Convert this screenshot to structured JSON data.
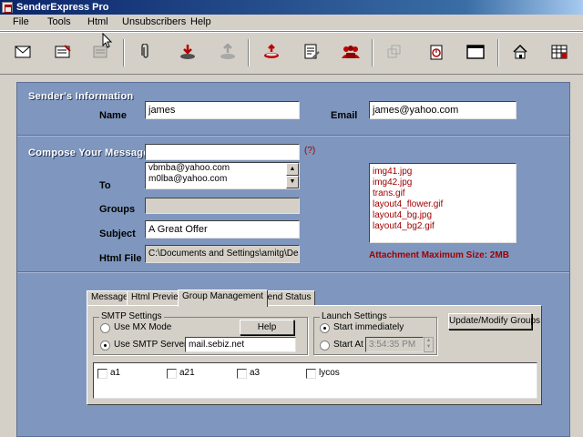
{
  "window": {
    "title": "SenderExpress Pro"
  },
  "menu": [
    "File",
    "Tools",
    "Html",
    "Unsubscribers",
    "Help"
  ],
  "toolbar": {
    "icons": [
      "envelope-icon",
      "compose-icon",
      "template-icon",
      "attach-icon",
      "download-icon",
      "upload-icon",
      "send-icon",
      "edit-icon",
      "group-icon",
      "copy-icon",
      "timer-icon",
      "window-icon",
      "home-icon",
      "grid-icon"
    ]
  },
  "sender": {
    "section_title": "Sender's Information",
    "name_label": "Name",
    "name_value": "james",
    "email_label": "Email",
    "email_value": "james@yahoo.com"
  },
  "compose": {
    "section_title": "Compose Your Message",
    "help_mark": "(?)",
    "to_label": "To",
    "to_list": [
      "vbmba@yahoo.com",
      "m0lba@yahoo.com"
    ],
    "groups_label": "Groups",
    "groups_value": "",
    "subject_label": "Subject",
    "subject_value": "A Great Offer",
    "htmlfile_label": "Html File",
    "htmlfile_value": "C:\\Documents and Settings\\amitg\\Desktop",
    "attachments": [
      "img41.jpg",
      "img42.jpg",
      "trans.gif",
      "layout4_flower.gif",
      "layout4_bg.jpg",
      "layout4_bg2.gif"
    ],
    "attachment_note": "Attachment Maximum Size: 2MB"
  },
  "tabs": [
    {
      "label": "Message",
      "active": false
    },
    {
      "label": "Html Preview",
      "active": false
    },
    {
      "label": "Group Management",
      "active": true
    },
    {
      "label": "Send Status",
      "active": false
    }
  ],
  "smtp": {
    "title": "SMTP Settings",
    "option_mx": "Use MX Mode",
    "option_smtp": "Use SMTP Server",
    "selected": "smtp",
    "server_value": "mail.sebiz.net",
    "help_button": "Help"
  },
  "launch": {
    "title": "Launch Settings",
    "option_immediate": "Start immediately",
    "option_at": "Start At",
    "selected": "immediate",
    "time_value": "3:54:35 PM"
  },
  "update_button": "Update/Modify Groups",
  "groups": [
    "a1",
    "a21",
    "a3",
    "lycos"
  ]
}
